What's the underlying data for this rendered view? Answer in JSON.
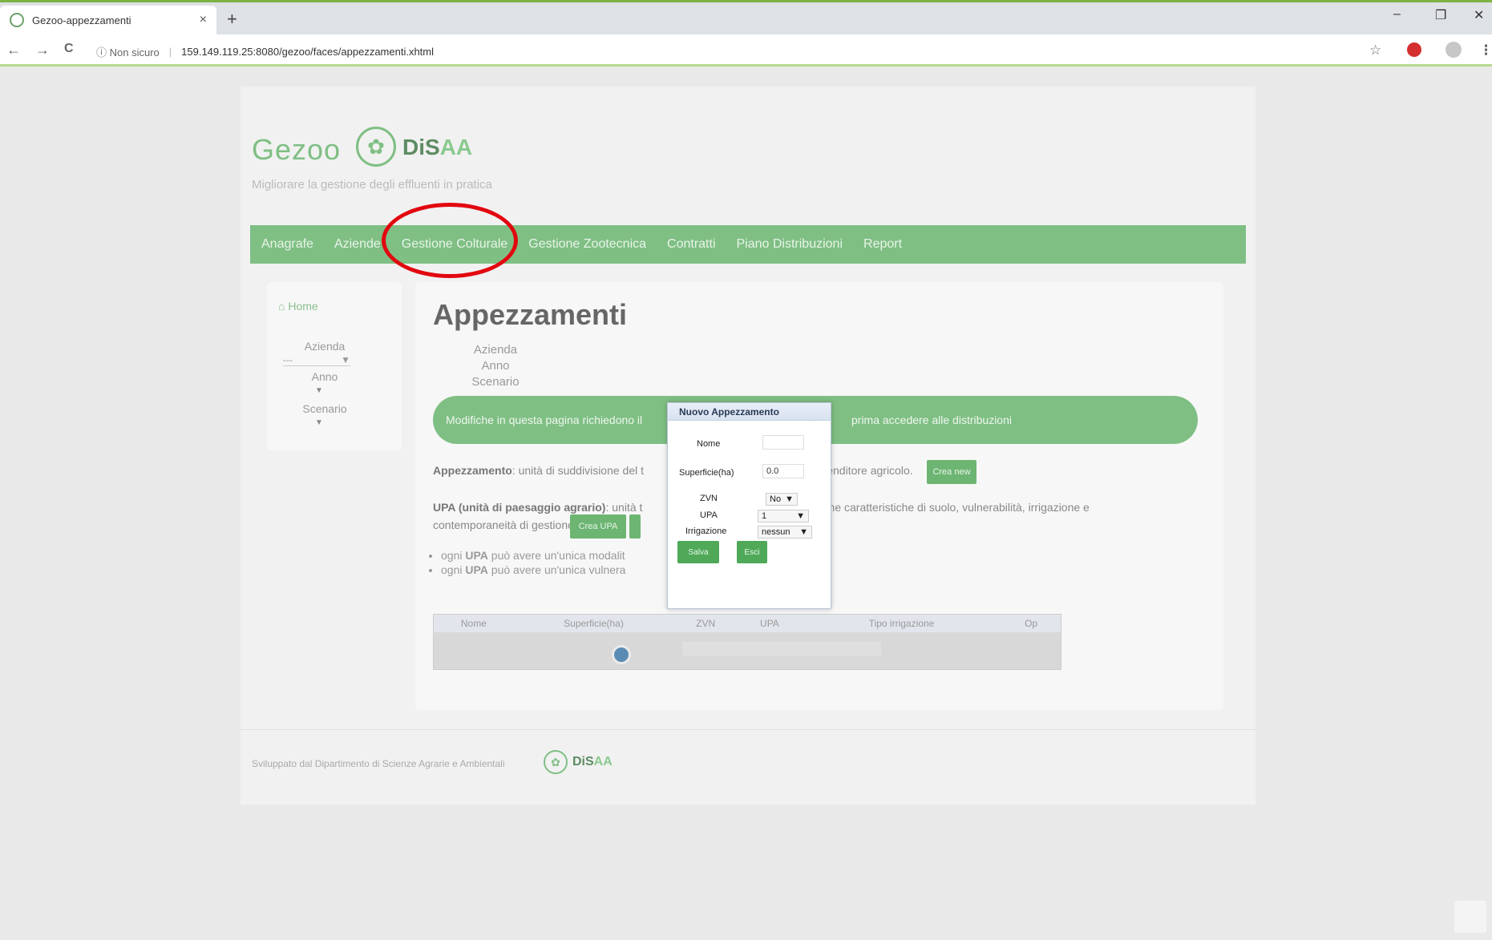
{
  "browser": {
    "tab_title": "Gezoo-appezzamenti",
    "tab_close": "×",
    "new_tab": "+",
    "win_minimize": "–",
    "win_restore": "❐",
    "win_close": "✕",
    "back": "←",
    "forward": "→",
    "reload": "C",
    "security": "ⓘ Non sicuro",
    "separator": "|",
    "url": "159.149.119.25:8080/gezoo/faces/appezzamenti.xhtml",
    "star": "☆",
    "menu": "⋮"
  },
  "site": {
    "logo": "Gezoo",
    "logo_icon": "✿",
    "disaa_prefix": "DiS",
    "disaa_suffix": "AA",
    "tagline": "Migliorare la gestione degli effluenti in pratica"
  },
  "menu": {
    "items": [
      "Anagrafe",
      "Aziende",
      "Gestione Colturale",
      "Gestione Zootecnica",
      "Contratti",
      "Piano Distribuzioni",
      "Report"
    ]
  },
  "sidebar": {
    "home": "Home",
    "home_icon": "⌂",
    "azienda_label": "Azienda",
    "azienda_value": "---",
    "anno_label": "Anno",
    "scenario_label": "Scenario",
    "arrow": "▼"
  },
  "main": {
    "title": "Appezzamenti",
    "filter_azienda": "Azienda",
    "filter_anno": "Anno",
    "filter_scenario": "Scenario",
    "banner_left": "Modifiche in questa pagina richiedono il",
    "banner_right": "prima accedere alle distribuzioni",
    "appezz_bold": "Appezzamento",
    "appezz_text": ": unità di suddivisione del t",
    "appezz_text2": "imprenditore agricolo.",
    "btn_crea": "Crea new",
    "upa_bold": "UPA (unità di paesaggio agrario)",
    "upa_text": ": unità t",
    "upa_text2": "desime caratteristiche di suolo, vulnerabilità, irrigazione e",
    "upa_line2": "contemporaneità di gestione.",
    "btn_upa": "Crea UPA",
    "bullet_prefix": "ogni",
    "bullet_upa": "UPA",
    "bullet1": " può avere un'unica modalit",
    "bullet2": " può avere un'unica vulnera"
  },
  "grid": {
    "columns": [
      "Nome",
      "Superficie(ha)",
      "ZVN",
      "UPA",
      "Tipo irrigazione",
      "Op"
    ]
  },
  "footer": {
    "text": "Sviluppato dal Dipartimento di Scienze Agrarie e Ambientali",
    "logo_prefix": "DiS",
    "logo_suffix": "AA"
  },
  "dialog": {
    "title": "Nuovo Appezzamento",
    "nome_label": "Nome",
    "nome_value": "",
    "superficie_label": "Superficie(ha)",
    "superficie_value": "0.0",
    "zvn_label": "ZVN",
    "zvn_value": "No",
    "upa_label": "UPA",
    "upa_value": "1",
    "irrigazione_label": "Irrigazione",
    "irrigazione_value": "nessun",
    "arrow": "▼",
    "save_label": "Salva",
    "close_label": "Esci"
  }
}
